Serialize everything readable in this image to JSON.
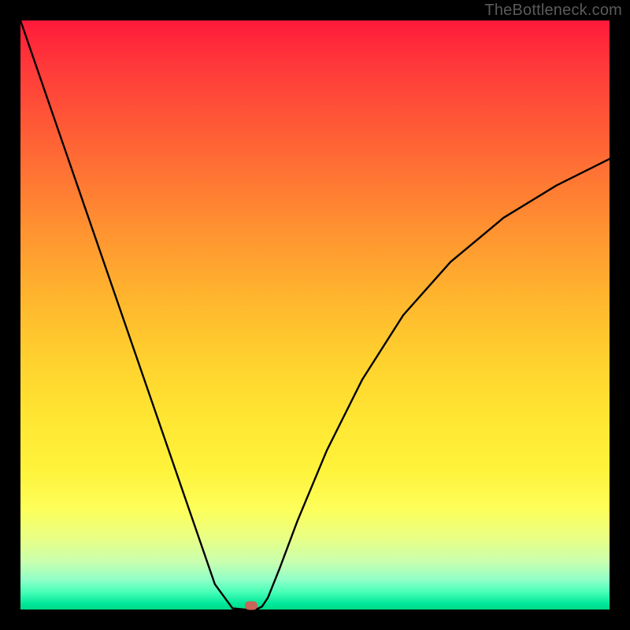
{
  "watermark": "TheBottleneck.com",
  "chart_data": {
    "type": "line",
    "title": "",
    "xlabel": "",
    "ylabel": "",
    "xlim": [
      0,
      100
    ],
    "ylim": [
      0,
      100
    ],
    "series": [
      {
        "name": "curve",
        "x": [
          0,
          5,
          10,
          15,
          20,
          25,
          30,
          33,
          36,
          38,
          39,
          40,
          41,
          42,
          44,
          47,
          52,
          58,
          65,
          73,
          82,
          91,
          100
        ],
        "y": [
          100,
          85.5,
          71,
          56.5,
          42,
          27.5,
          13,
          4.3,
          0.2,
          0,
          0,
          0,
          0.5,
          2,
          7,
          15,
          27,
          39,
          50,
          59,
          66.5,
          72,
          76.5
        ]
      }
    ],
    "marker": {
      "x": 39.2,
      "y": 0.7
    },
    "gradient_stops": [
      {
        "pos": 0,
        "color": "#ff1a3a"
      },
      {
        "pos": 50,
        "color": "#ffc82e"
      },
      {
        "pos": 85,
        "color": "#fcff60"
      },
      {
        "pos": 100,
        "color": "#00d888"
      }
    ]
  }
}
